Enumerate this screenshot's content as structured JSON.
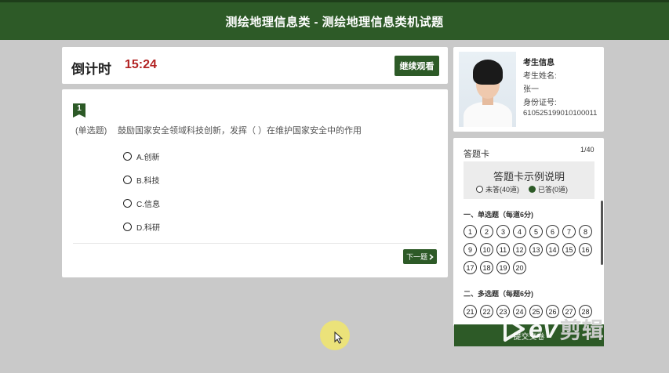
{
  "header": {
    "title": "测绘地理信息类 - 测绘地理信息类机试题"
  },
  "timer": {
    "label": "倒计时",
    "value": "15:24",
    "continue_label": "继续观看"
  },
  "question": {
    "number": "1",
    "type": "(单选题)",
    "text": "鼓励国家安全领域科技创新，发挥（ ）在维护国家安全中的作用",
    "options": [
      "A.创新",
      "B.科技",
      "C.信息",
      "D.科研"
    ],
    "next_label": "下一题",
    "next_icon": "chevron-right-icon"
  },
  "candidate": {
    "title": "考生信息",
    "name_label": "考生姓名:",
    "name": "张一",
    "id_label": "身份证号:",
    "id": "610525199010100011"
  },
  "answer_card": {
    "title": "答题卡",
    "count": "1/40",
    "legend_title": "答题卡示例说明",
    "legend_unanswered": "未答(40道)",
    "legend_answered": "已答(0道)",
    "section1_title": "一、单选题（每道6分)",
    "section1_numbers": [
      "1",
      "2",
      "3",
      "4",
      "5",
      "6",
      "7",
      "8",
      "9",
      "10",
      "11",
      "12",
      "13",
      "14",
      "15",
      "16",
      "17",
      "18",
      "19",
      "20"
    ],
    "section2_title": "二、多选题（每题6分)",
    "section2_numbers": [
      "21",
      "22",
      "23",
      "24",
      "25",
      "26",
      "27",
      "28"
    ]
  },
  "submit": {
    "label": "提交交卷"
  },
  "watermark": {
    "brand": "ev",
    "suffix": "剪辑"
  },
  "colors": {
    "accent": "#2d5a27",
    "timer": "#b22222",
    "background": "#c9c9c9"
  }
}
